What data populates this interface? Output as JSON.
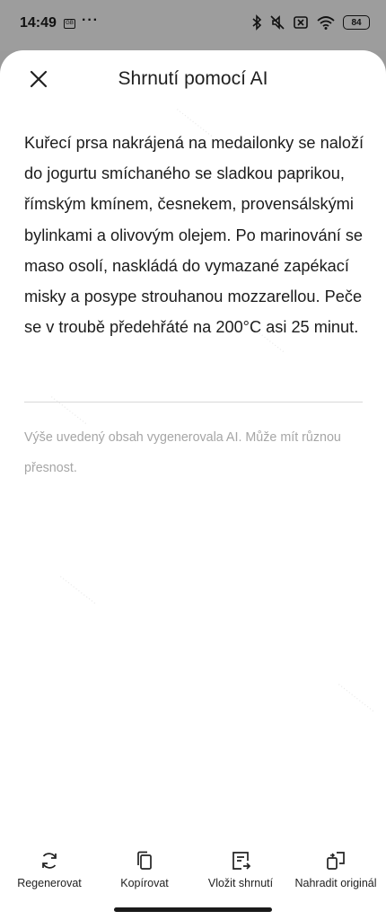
{
  "status_bar": {
    "time": "14:49",
    "app_icon_text": "GB",
    "more": "···",
    "battery": "84"
  },
  "header": {
    "title": "Shrnutí pomocí AI"
  },
  "summary": {
    "text": "Kuřecí prsa nakrájená na medailonky se naloží do jogurtu smíchaného se sladkou paprikou, římským kmínem, česnekem, provensálskými bylinkami a olivovým olejem. Po marinování se maso osolí, naskládá do vymazané zapékací misky a posype strouhanou mozzarellou. Peče se v troubě předehřáté na 200°C asi 25 minut."
  },
  "disclaimer": {
    "text": "Výše uvedený obsah vygenerovala AI. Může mít různou přesnost."
  },
  "toolbar": {
    "regenerate": "Regenerovat",
    "copy": "Kopírovat",
    "insert": "Vložit shrnutí",
    "replace": "Nahradit originál"
  },
  "icons": {
    "close": "close-icon",
    "regenerate": "refresh-icon",
    "copy": "copy-icon",
    "insert": "insert-summary-icon",
    "replace": "replace-icon"
  }
}
